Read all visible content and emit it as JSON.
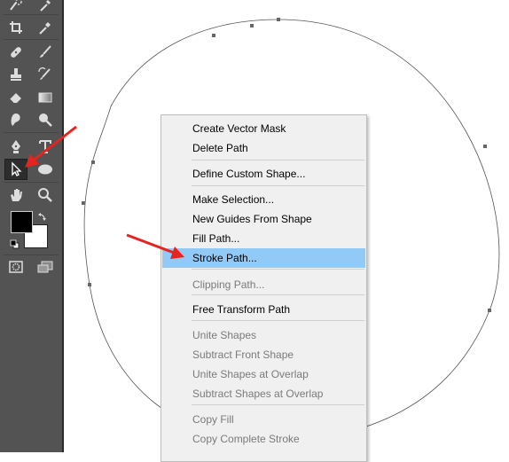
{
  "toolbar": {
    "tools": [
      {
        "name": "quick-selection-icon"
      },
      {
        "name": "eyedropper-icon"
      },
      {
        "name": "crop-icon"
      },
      {
        "name": "eyedropper-icon"
      },
      {
        "name": "healing-brush-icon"
      },
      {
        "name": "brush-icon"
      },
      {
        "name": "clone-stamp-icon"
      },
      {
        "name": "history-brush-icon"
      },
      {
        "name": "eraser-icon"
      },
      {
        "name": "gradient-icon"
      },
      {
        "name": "blur-icon"
      },
      {
        "name": "dodge-icon"
      },
      {
        "name": "pen-icon"
      },
      {
        "name": "type-icon"
      },
      {
        "name": "direct-selection-icon",
        "active": true
      },
      {
        "name": "ellipse-icon"
      },
      {
        "name": "hand-icon"
      },
      {
        "name": "zoom-icon"
      }
    ],
    "foreground_color": "#000000",
    "background_color": "#ffffff"
  },
  "context_menu": {
    "items": [
      {
        "label": "Create Vector Mask",
        "enabled": true
      },
      {
        "label": "Delete Path",
        "enabled": true
      },
      {
        "label": "Define Custom Shape...",
        "enabled": true
      },
      {
        "label": "Make Selection...",
        "enabled": true
      },
      {
        "label": "New Guides From Shape",
        "enabled": true
      },
      {
        "label": "Fill Path...",
        "enabled": true
      },
      {
        "label": "Stroke Path...",
        "enabled": true,
        "highlighted": true
      },
      {
        "label": "Clipping Path...",
        "enabled": false
      },
      {
        "label": "Free Transform Path",
        "enabled": true
      },
      {
        "label": "Unite Shapes",
        "enabled": false
      },
      {
        "label": "Subtract Front Shape",
        "enabled": false
      },
      {
        "label": "Unite Shapes at Overlap",
        "enabled": false
      },
      {
        "label": "Subtract Shapes at Overlap",
        "enabled": false
      },
      {
        "label": "Copy Fill",
        "enabled": false
      },
      {
        "label": "Copy Complete Stroke",
        "enabled": false
      }
    ]
  },
  "colors": {
    "highlight": "#91c9f7",
    "arrow": "#e8231f",
    "toolbar": "#535353"
  }
}
